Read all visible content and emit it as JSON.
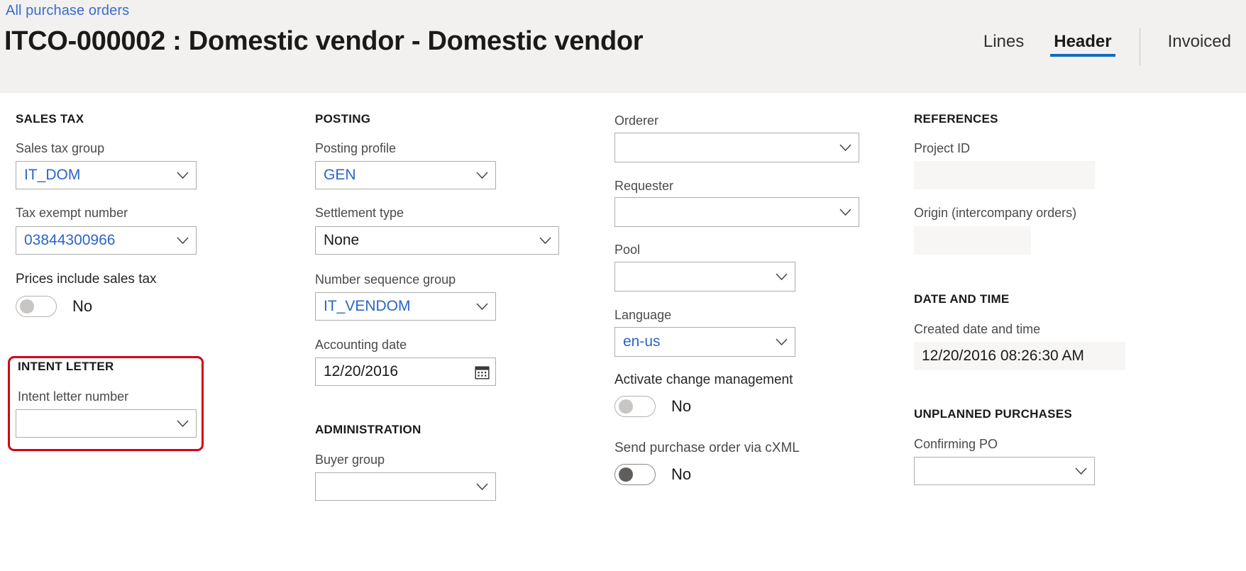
{
  "header": {
    "breadcrumb": "All purchase orders",
    "title": "ITCO-000002 : Domestic vendor - Domestic vendor",
    "tabs": [
      {
        "label": "Lines",
        "active": false
      },
      {
        "label": "Header",
        "active": true
      },
      {
        "label": "Invoiced",
        "active": false
      }
    ]
  },
  "sales_tax": {
    "group_title": "SALES TAX",
    "sales_tax_group": {
      "label": "Sales tax group",
      "value": "IT_DOM"
    },
    "tax_exempt_number": {
      "label": "Tax exempt number",
      "value": "03844300966"
    },
    "prices_include_sales_tax": {
      "label": "Prices include sales tax",
      "value": "No",
      "state": "off"
    }
  },
  "intent_letter": {
    "group_title": "INTENT LETTER",
    "intent_letter_number": {
      "label": "Intent letter number",
      "value": ""
    },
    "highlight_color": "#d0021b"
  },
  "posting": {
    "group_title": "POSTING",
    "posting_profile": {
      "label": "Posting profile",
      "value": "GEN"
    },
    "settlement_type": {
      "label": "Settlement type",
      "value": "None"
    },
    "number_sequence_group": {
      "label": "Number sequence group",
      "value": "IT_VENDOM"
    },
    "accounting_date": {
      "label": "Accounting date",
      "value": "12/20/2016"
    }
  },
  "administration": {
    "group_title": "ADMINISTRATION",
    "buyer_group": {
      "label": "Buyer group",
      "value": ""
    }
  },
  "people": {
    "orderer": {
      "label": "Orderer",
      "value": ""
    },
    "requester": {
      "label": "Requester",
      "value": ""
    },
    "pool": {
      "label": "Pool",
      "value": ""
    },
    "language": {
      "label": "Language",
      "value": "en-us"
    },
    "activate_change_management": {
      "label": "Activate change management",
      "value": "No",
      "state": "off"
    },
    "send_po_via_cxml": {
      "label": "Send purchase order via cXML",
      "value": "No",
      "state": "off"
    }
  },
  "references": {
    "group_title": "REFERENCES",
    "project_id": {
      "label": "Project ID",
      "value": ""
    },
    "origin": {
      "label": "Origin (intercompany orders)",
      "value": ""
    }
  },
  "date_and_time": {
    "group_title": "DATE AND TIME",
    "created_date_and_time": {
      "label": "Created date and time",
      "value": "12/20/2016 08:26:30 AM"
    }
  },
  "unplanned_purchases": {
    "group_title": "UNPLANNED PURCHASES",
    "confirming_po": {
      "label": "Confirming PO",
      "value": ""
    }
  },
  "colors": {
    "accent": "#0f6cbd",
    "link": "#3b6ccb",
    "value_link": "#2a66c8",
    "annotation": "#d0021b",
    "appbar_bg": "#f2f1f0"
  }
}
